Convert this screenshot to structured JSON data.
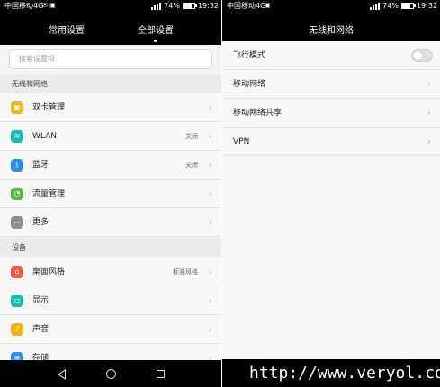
{
  "left_screen": {
    "status_bar": {
      "carrier": "中国移动4G",
      "status_icons": "✉ ▣",
      "battery": "74%",
      "time": "19:32"
    },
    "tabs": [
      {
        "label": "常用设置",
        "active": false
      },
      {
        "label": "全部设置",
        "active": true
      }
    ],
    "search": {
      "placeholder": "搜索设置项"
    },
    "sections": [
      {
        "header": "无线和网络",
        "items": [
          {
            "label": "双卡管理",
            "value": "",
            "icon": "dual-sim-icon",
            "color": "#f0b514",
            "glyph": "▣"
          },
          {
            "label": "WLAN",
            "value": "关闭",
            "icon": "wifi-icon",
            "color": "#1ab9b2",
            "glyph": "≋"
          },
          {
            "label": "蓝牙",
            "value": "关闭",
            "icon": "bluetooth-icon",
            "color": "#2f8fe4",
            "glyph": "ᛒ"
          },
          {
            "label": "流量管理",
            "value": "",
            "icon": "data-usage-icon",
            "color": "#58b845",
            "glyph": "◔"
          },
          {
            "label": "更多",
            "value": "",
            "icon": "more-icon",
            "color": "#8e8e8e",
            "glyph": "⋯"
          }
        ]
      },
      {
        "header": "设备",
        "items": [
          {
            "label": "桌面风格",
            "value": "标准风格",
            "icon": "home-style-icon",
            "color": "#f05a4a",
            "glyph": "⌂"
          },
          {
            "label": "显示",
            "value": "",
            "icon": "display-icon",
            "color": "#1ab9b2",
            "glyph": "▭"
          },
          {
            "label": "声音",
            "value": "",
            "icon": "sound-icon",
            "color": "#f0b514",
            "glyph": "♪"
          },
          {
            "label": "存储",
            "value": "",
            "icon": "storage-icon",
            "color": "#2f8fe4",
            "glyph": "≡"
          }
        ]
      }
    ]
  },
  "right_screen": {
    "status_bar": {
      "carrier": "中国移动4G",
      "status_icons": "▣",
      "battery": "74%",
      "time": "19:32"
    },
    "title": "无线和网络",
    "items": [
      {
        "label": "飞行模式",
        "type": "toggle",
        "toggle_on": false
      },
      {
        "label": "移动网络",
        "type": "link"
      },
      {
        "label": "移动网络共享",
        "type": "link"
      },
      {
        "label": "VPN",
        "type": "link"
      }
    ]
  },
  "navigation_bar": {
    "back": "back-icon",
    "home": "home-icon",
    "recent": "recent-apps-icon"
  },
  "watermark": "http://www.veryol.com"
}
